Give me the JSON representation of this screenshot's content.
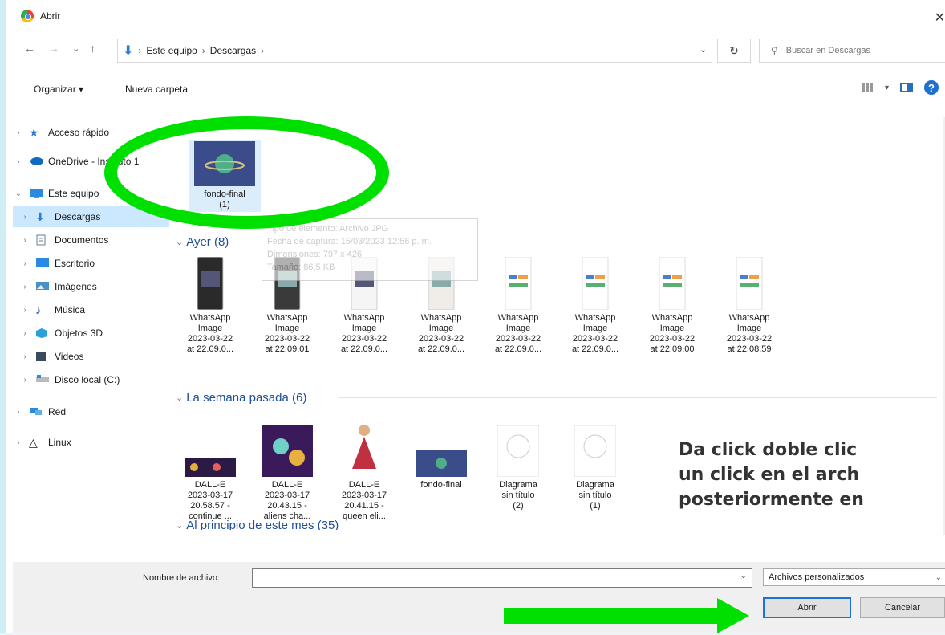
{
  "window": {
    "title": "Abrir",
    "close_glyph": "✕"
  },
  "nav": {
    "back": "←",
    "forward": "→",
    "recent": "⌄",
    "up": "↑",
    "path": [
      "Este equipo",
      "Descargas"
    ],
    "search_placeholder": "Buscar en Descargas"
  },
  "toolbar": {
    "organize": "Organizar ▾",
    "new_folder": "Nueva carpeta"
  },
  "sidebar": {
    "items": [
      {
        "label": "Acceso rápido",
        "icon": "star-icon"
      },
      {
        "label": "OneDrive - Instituto 1",
        "icon": "cloud-icon"
      },
      {
        "label": "Este equipo",
        "icon": "computer-icon"
      },
      {
        "label": "Descargas",
        "icon": "download-icon"
      },
      {
        "label": "Documentos",
        "icon": "document-icon"
      },
      {
        "label": "Escritorio",
        "icon": "desktop-icon"
      },
      {
        "label": "Imágenes",
        "icon": "images-icon"
      },
      {
        "label": "Música",
        "icon": "music-icon"
      },
      {
        "label": "Objetos 3D",
        "icon": "cube-icon"
      },
      {
        "label": "Videos",
        "icon": "video-icon"
      },
      {
        "label": "Disco local (C:)",
        "icon": "drive-icon"
      },
      {
        "label": "Red",
        "icon": "network-icon"
      },
      {
        "label": "Linux",
        "icon": "linux-icon"
      }
    ]
  },
  "groups": {
    "ayer": "Ayer (8)",
    "semana": "La semana pasada (6)",
    "mes": "Al principio de este mes (35)"
  },
  "files": {
    "top": [
      {
        "line1": "fondo-final",
        "line2": "(1)"
      }
    ],
    "ayer": [
      {
        "l1": "WhatsApp",
        "l2": "Image",
        "l3": "2023-03-22",
        "l4": "at 22.09.0..."
      },
      {
        "l1": "WhatsApp",
        "l2": "Image",
        "l3": "2023-03-22",
        "l4": "at 22.09.01"
      },
      {
        "l1": "WhatsApp",
        "l2": "Image",
        "l3": "2023-03-22",
        "l4": "at 22.09.0..."
      },
      {
        "l1": "WhatsApp",
        "l2": "Image",
        "l3": "2023-03-22",
        "l4": "at 22.09.0..."
      },
      {
        "l1": "WhatsApp",
        "l2": "Image",
        "l3": "2023-03-22",
        "l4": "at 22.09.0..."
      },
      {
        "l1": "WhatsApp",
        "l2": "Image",
        "l3": "2023-03-22",
        "l4": "at 22.09.0..."
      },
      {
        "l1": "WhatsApp",
        "l2": "Image",
        "l3": "2023-03-22",
        "l4": "at 22.09.00"
      },
      {
        "l1": "WhatsApp",
        "l2": "Image",
        "l3": "2023-03-22",
        "l4": "at 22.08.59"
      }
    ],
    "semana": [
      {
        "l1": "DALL-E",
        "l2": "2023-03-17",
        "l3": "20.58.57 -",
        "l4": "continue ..."
      },
      {
        "l1": "DALL-E",
        "l2": "2023-03-17",
        "l3": "20.43.15 -",
        "l4": "aliens cha..."
      },
      {
        "l1": "DALL-E",
        "l2": "2023-03-17",
        "l3": "20.41.15 -",
        "l4": "queen eli..."
      },
      {
        "l1": "fondo-final",
        "l2": "",
        "l3": "",
        "l4": ""
      },
      {
        "l1": "Diagrama",
        "l2": "sin título",
        "l3": "(2)",
        "l4": ""
      },
      {
        "l1": "Diagrama",
        "l2": "sin título",
        "l3": "(1)",
        "l4": ""
      }
    ]
  },
  "tooltip": {
    "l1": "Tipo de elemento: Archivo JPG",
    "l2": "Fecha de captura: 15/03/2023 12:56 p. m.",
    "l3": "Dimensiones: 797 x 426",
    "l4": "Tamaño: 86,5 KB"
  },
  "footer": {
    "filename_label": "Nombre de archivo:",
    "filename_value": "",
    "filter": "Archivos personalizados",
    "open": "Abrir",
    "cancel": "Cancelar"
  },
  "annotation": {
    "l1": "Da click doble clic",
    "l2": "un click en el arch",
    "l3": "posteriormente en"
  },
  "colors": {
    "highlight": "#00e000",
    "selection": "#cce8ff",
    "link": "#1f4e99"
  }
}
